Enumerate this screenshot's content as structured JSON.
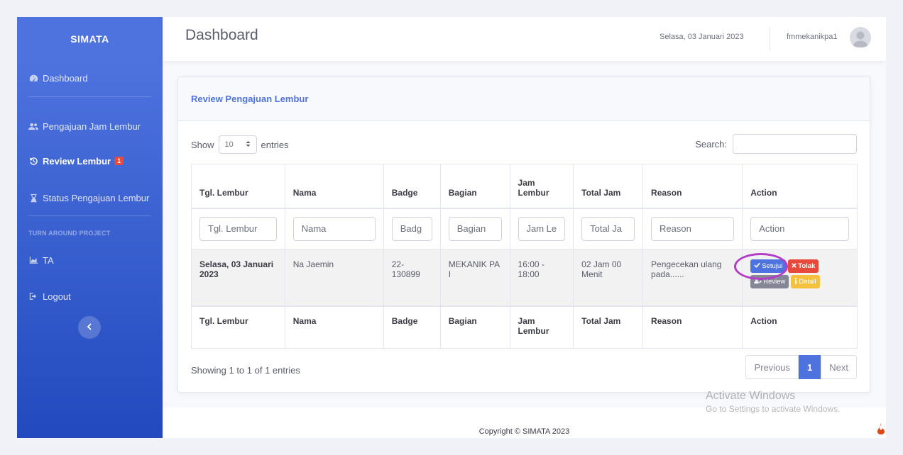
{
  "brand": "SIMATA",
  "sidebar": {
    "items": [
      {
        "label": "Dashboard",
        "icon": "dashboard-icon"
      },
      {
        "label": "Pengajuan Jam Lembur",
        "icon": "users-icon"
      },
      {
        "label": "Review Lembur",
        "icon": "history-icon",
        "badge": "1",
        "active": true
      },
      {
        "label": "Status Pengajuan Lembur",
        "icon": "hourglass-icon"
      }
    ],
    "heading": "TURN AROUND PROJECT",
    "ta_item": {
      "label": "TA",
      "icon": "chart-area-icon"
    },
    "logout": {
      "label": "Logout",
      "icon": "logout-icon"
    },
    "toggle_icon": "chevron-left-icon"
  },
  "topbar": {
    "title": "Dashboard",
    "date": "Selasa, 03 Januari 2023",
    "username": "fmmekanikpa1"
  },
  "card": {
    "title": "Review Pengajuan Lembur",
    "show_label": "Show",
    "entries_label": "entries",
    "length_value": "10",
    "search_label": "Search:",
    "columns": [
      "Tgl. Lembur",
      "Nama",
      "Badge",
      "Bagian",
      "Jam Lembur",
      "Total Jam",
      "Reason",
      "Action"
    ],
    "filters": [
      "Tgl. Lembur",
      "Nama",
      "Badg",
      "Bagian",
      "Jam Le",
      "Total Ja",
      "Reason",
      "Action"
    ],
    "rows": [
      {
        "tgl": "Selasa, 03 Januari 2023",
        "nama": "Na Jaemin",
        "badge": "22-130899",
        "bagian": "MEKANIK PA I",
        "jam": "16:00 - 18:00",
        "total": "02 Jam 00 Menit",
        "reason": "Pengecekan ulang pada......"
      }
    ],
    "actions": {
      "approve": "Setujui",
      "reject": "Tolak",
      "review": "Review",
      "detail": "Detail"
    },
    "info": "Showing 1 to 1 of 1 entries",
    "pagination": {
      "prev": "Previous",
      "current": "1",
      "next": "Next"
    }
  },
  "footer": {
    "copyright": "Copyright © SIMATA 2023"
  },
  "watermark": {
    "line1": "Activate Windows",
    "line2": "Go to Settings to activate Windows."
  },
  "colors": {
    "primary": "#4e73df",
    "danger": "#e74a3b",
    "warning": "#f6c23e",
    "secondary": "#858796",
    "annotation": "#b23ec7"
  }
}
